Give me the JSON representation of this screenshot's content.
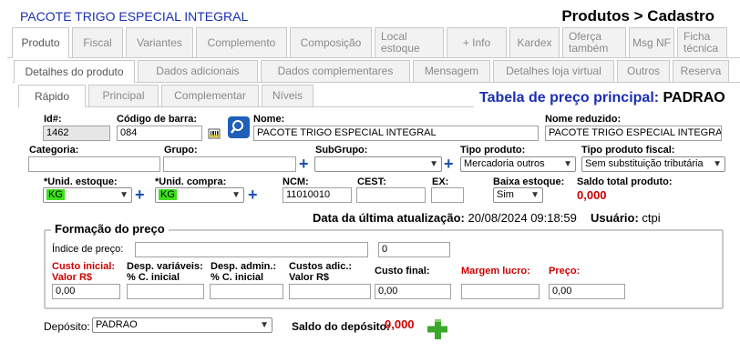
{
  "header": {
    "product_name": "PACOTE TRIGO ESPECIAL INTEGRAL",
    "breadcrumb": "Produtos > Cadastro"
  },
  "tabs_level1": [
    "Produto",
    "Fiscal",
    "Variantes",
    "Complemento",
    "Composição",
    "Local estoque",
    "+ Info",
    "Kardex",
    "Oferça também",
    "Msg NF",
    "Ficha técnica"
  ],
  "tabs_level2": [
    "Detalhes do produto",
    "Dados adicionais",
    "Dados complementares",
    "Mensagem",
    "Detalhes loja virtual",
    "Outros",
    "Reserva"
  ],
  "tabs_level3": [
    "Rápido",
    "Principal",
    "Complementar",
    "Níveis"
  ],
  "price_table": {
    "label": "Tabela de preço principal:",
    "value": "PADRAO"
  },
  "form": {
    "id_label": "Id#:",
    "id_value": "1462",
    "barcode_label": "Código de barra:",
    "barcode_value": "084",
    "name_label": "Nome:",
    "name_value": "PACOTE TRIGO ESPECIAL INTEGRAL",
    "short_name_label": "Nome reduzido:",
    "short_name_value": "PACOTE TRIGO ESPECIAL INTEGRA",
    "category_label": "Categoria:",
    "category_value": "",
    "group_label": "Grupo:",
    "group_value": "",
    "subgroup_label": "SubGrupo:",
    "subgroup_value": "",
    "product_type_label": "Tipo produto:",
    "product_type_value": "Mercadoria outros",
    "fiscal_type_label": "Tipo produto fiscal:",
    "fiscal_type_value": "Sem substituição tributária",
    "stock_unit_label": "*Unid. estoque:",
    "stock_unit_value": "KG",
    "purchase_unit_label": "*Unid. compra:",
    "purchase_unit_value": "KG",
    "ncm_label": "NCM:",
    "ncm_value": "11010010",
    "cest_label": "CEST:",
    "cest_value": "",
    "ex_label": "EX:",
    "ex_value": "",
    "stock_drop_label": "Baixa estoque:",
    "stock_drop_value": "Sim",
    "stock_total_label": "Saldo total produto:",
    "stock_total_value": "0,000",
    "last_update_label": "Data da última atualização:",
    "last_update_value": "20/08/2024 09:18:59",
    "user_label": "Usuário:",
    "user_value": "ctpi"
  },
  "pricing": {
    "title": "Formação do preço",
    "index_label": "Índice de preço:",
    "index_value": "",
    "index_code": "0",
    "initial_cost_label_1": "Custo inicial:",
    "initial_cost_label_2": "Valor R$",
    "initial_cost_value": "0,00",
    "var_exp_label_1": "Desp. variáveis:",
    "var_exp_label_2": "% C. inicial",
    "var_exp_value": "",
    "admin_exp_label_1": "Desp. admin.:",
    "admin_exp_label_2": "% C. inicial",
    "admin_exp_value": "",
    "extra_cost_label_1": "Custos adic.:",
    "extra_cost_label_2": "Valor R$",
    "extra_cost_value": "",
    "final_cost_label": "Custo final:",
    "final_cost_value": "0,00",
    "margin_label": "Margem lucro:",
    "margin_value": "",
    "price_label": "Preço:",
    "price_value": "0,00"
  },
  "deposit": {
    "label": "Depósito:",
    "value": "PADRAO",
    "balance_label": "Saldo do depósito:",
    "balance_value": "0,000"
  },
  "colors": {
    "title_blue": "#1a2fb0",
    "required_red": "#cc0000",
    "highlight_green": "#3ee01c",
    "add_green": "#3aa82a",
    "plus_blue": "#1a4fb5"
  }
}
